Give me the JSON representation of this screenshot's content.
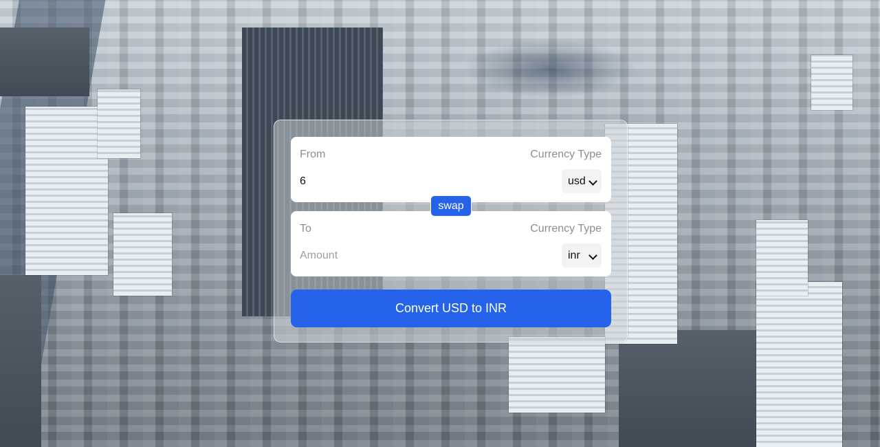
{
  "converter": {
    "from": {
      "label": "From",
      "currency_type_label": "Currency Type",
      "amount_value": "6",
      "currency_selected": "usd"
    },
    "swap_label": "swap",
    "to": {
      "label": "To",
      "currency_type_label": "Currency Type",
      "amount_placeholder": "Amount",
      "currency_selected": "inr"
    },
    "convert_button_label": "Convert USD to INR"
  },
  "colors": {
    "accent": "#2563eb",
    "panel_bg": "#ffffff",
    "muted_text": "#8a8f96"
  },
  "icons": {
    "select_arrow": "chevron-down-icon"
  }
}
